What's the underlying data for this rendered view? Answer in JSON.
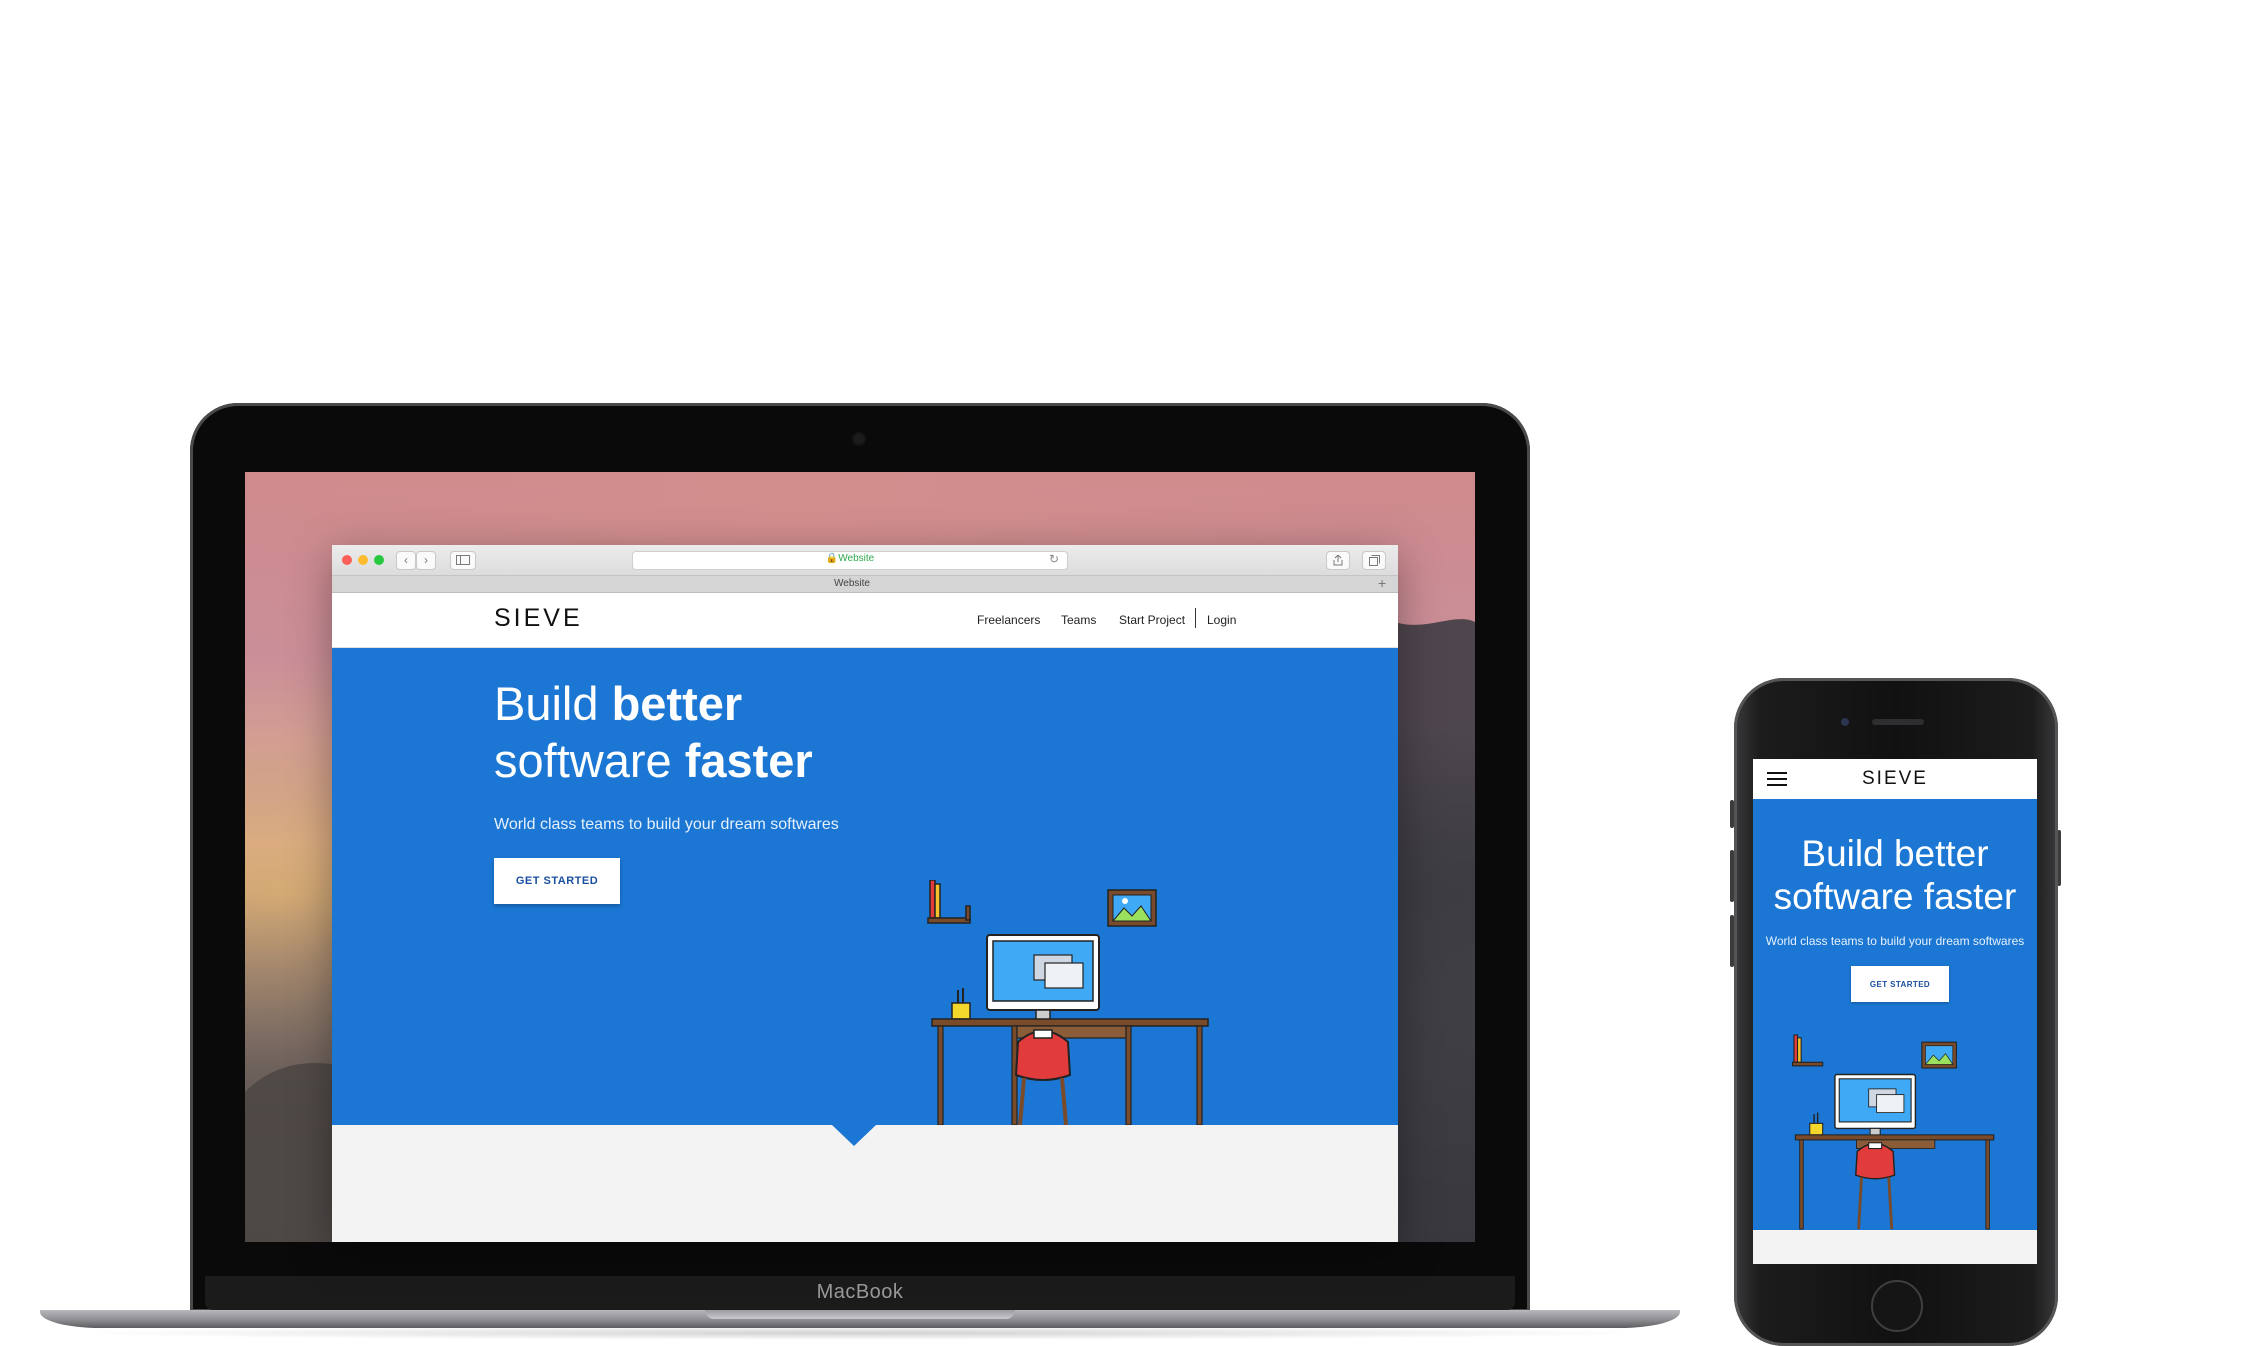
{
  "laptop": {
    "brand": "MacBook",
    "browser": {
      "address": "🔒Website",
      "tab_title": "Website",
      "tab_plus": "+",
      "reload_icon": "↻"
    },
    "site": {
      "logo": "SIEVE",
      "nav": {
        "freelancers": "Freelancers",
        "teams": "Teams",
        "start_project": "Start Project",
        "login": "Login"
      },
      "hero": {
        "title_line1_light": "Build ",
        "title_line1_bold": "better",
        "title_line2_light": "software ",
        "title_line2_bold": "faster",
        "subtitle": "World class teams to build your dream softwares",
        "cta": "GET STARTED"
      }
    }
  },
  "phone": {
    "logo": "SIEVE",
    "hero": {
      "title_line1": "Build better",
      "title_line2": "software faster",
      "subtitle": "World class teams to build your dream softwares",
      "cta": "GET STARTED"
    }
  },
  "colors": {
    "hero_blue": "#1b77d3",
    "chair_red": "#e23b3b",
    "desk_brown": "#7a4b2a",
    "screen_blue": "#3fa9f5"
  },
  "icons": [
    "lock-icon",
    "chevron-left-icon",
    "chevron-right-icon",
    "sidebar-icon",
    "reload-icon",
    "share-icon",
    "tabs-icon",
    "plus-icon",
    "hamburger-menu-icon"
  ]
}
